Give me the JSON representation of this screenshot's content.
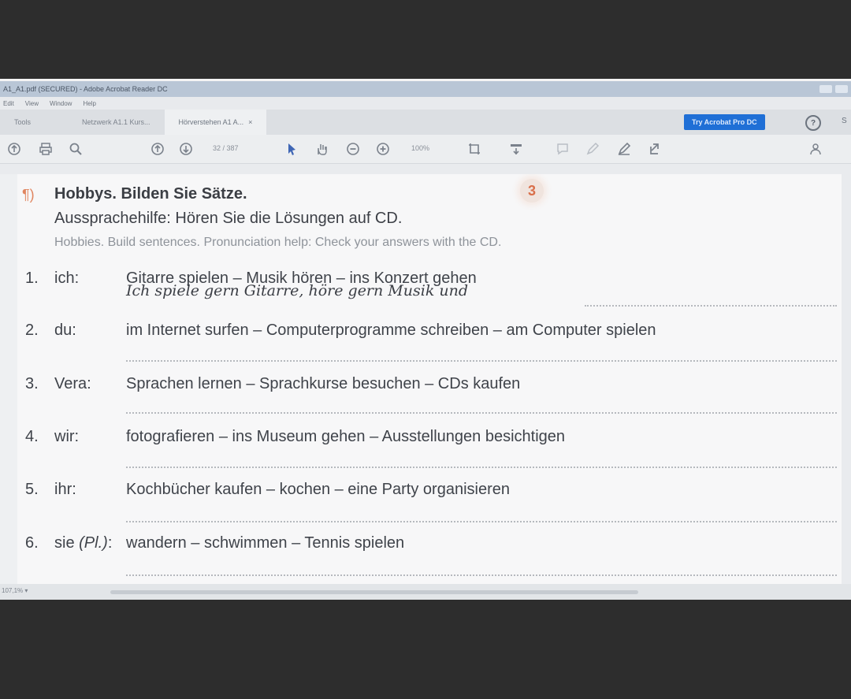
{
  "window": {
    "title": "A1_A1.pdf (SECURED) - Adobe Acrobat Reader DC",
    "menus": [
      "Edit",
      "View",
      "Window",
      "Help"
    ]
  },
  "tabs": [
    {
      "label": "Tools"
    },
    {
      "label": "Netzwerk A1.1 Kurs..."
    },
    {
      "label": "Hörverstehen A1 A...",
      "close": "×"
    }
  ],
  "header_right": {
    "try_button": "Try Acrobat Pro DC",
    "help": "?",
    "sign_in": "S"
  },
  "toolbar": {
    "page_indicator": "32 / 387",
    "zoom": "100%"
  },
  "exercise": {
    "icon": "¶)",
    "title": "Hobbys. Bilden Sie Sätze.",
    "subtitle": "Aussprachehilfe: Hören Sie die Lösungen auf CD.",
    "translation": "Hobbies. Build sentences. Pronunciation help: Check your answers with the CD.",
    "badge": "3",
    "items": [
      {
        "num": "1.",
        "subject": "ich:",
        "task": "Gitarre spielen – Musik hören – ins Konzert gehen"
      },
      {
        "num": "2.",
        "subject": "du:",
        "task": "im Internet surfen – Computerprogramme schreiben – am Computer spielen"
      },
      {
        "num": "3.",
        "subject": "Vera:",
        "task": "Sprachen lernen – Sprachkurse besuchen – CDs kaufen"
      },
      {
        "num": "4.",
        "subject": "wir:",
        "task": "fotografieren – ins Museum gehen – Ausstellungen besichtigen"
      },
      {
        "num": "5.",
        "subject": "ihr:",
        "task": "Kochbücher kaufen – kochen – eine Party organisieren"
      },
      {
        "num": "6.",
        "subject_pre": "sie",
        "subject_it": "(Pl.)",
        "subject_post": ":",
        "task": "wandern – schwimmen – Tennis spielen"
      }
    ],
    "example_answer": "Ich spiele gern Gitarre, höre gern Musik und"
  },
  "statusbar": {
    "zoom_label": "107,1% ▾"
  },
  "colors": {
    "accent": "#1f6fd6",
    "exercise_orange": "#d9704b"
  }
}
